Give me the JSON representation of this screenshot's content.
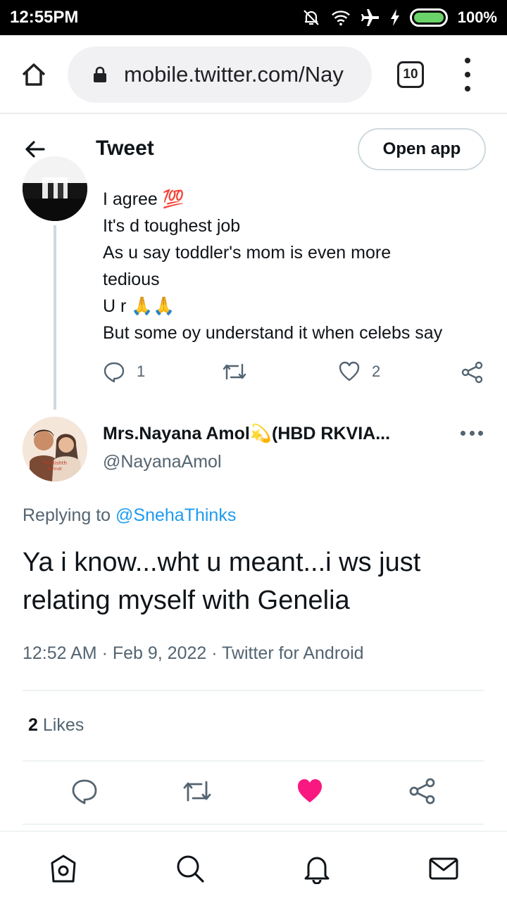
{
  "status_bar": {
    "time": "12:55PM",
    "battery_pct": "100%",
    "battery_level": 1.0
  },
  "browser": {
    "url": "mobile.twitter.com/Nay",
    "tab_count": "10"
  },
  "header": {
    "title": "Tweet",
    "open_app_label": "Open app"
  },
  "parent_tweet": {
    "lines": [
      "I agree 💯",
      "It's d toughest job",
      "As u say toddler's mom is even more",
      "tedious",
      "U r 🙏🙏",
      "But some oy understand it when celebs say"
    ],
    "reply_count": "1",
    "like_count": "2"
  },
  "tweet": {
    "author_name": "Mrs.Nayana Amol💫(HBD RKVIA...",
    "author_handle": "@NayanaAmol",
    "replying_prefix": "Replying to",
    "replying_mention": "@SnehaThinks",
    "text": "Ya i know...wht u meant...i ws just relating myself with Genelia",
    "meta": "12:52 AM · Feb 9, 2022 · Twitter for Android",
    "likes_count": "2",
    "likes_label": "Likes",
    "liked": true,
    "like_color": "#f91880"
  },
  "colors": {
    "accent": "#1d9bf0",
    "secondary_text": "#536471",
    "primary_text": "#0f1419"
  },
  "bottom_nav": {
    "items": [
      "home-icon",
      "explore-icon",
      "notifications-icon",
      "messages-icon"
    ]
  }
}
